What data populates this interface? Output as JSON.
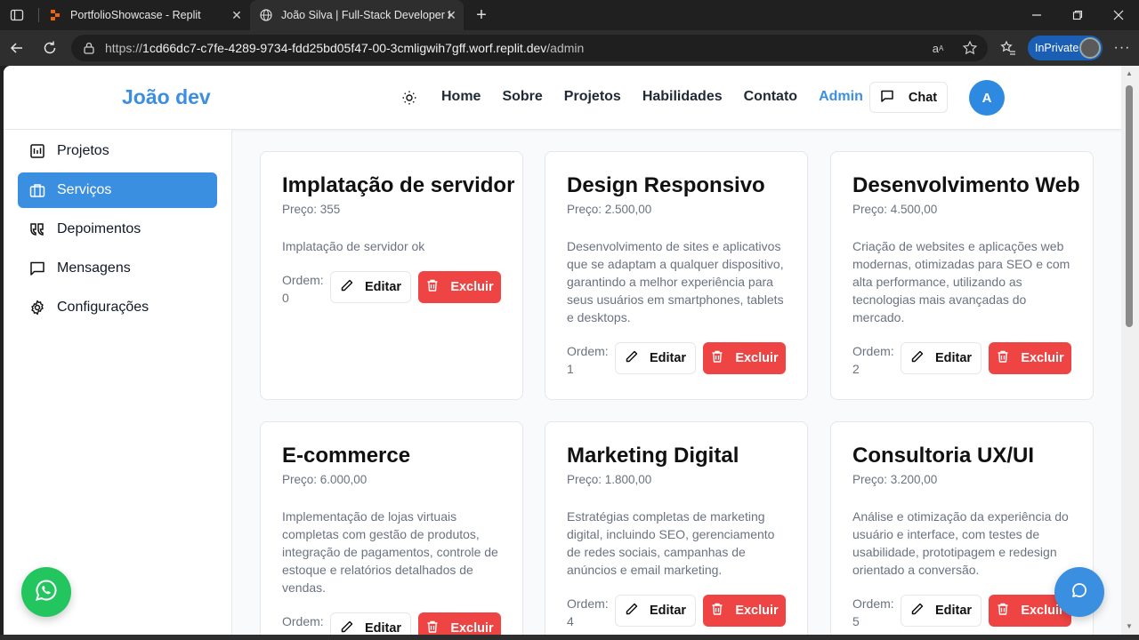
{
  "browser": {
    "tabs": [
      {
        "title": "PortfolioShowcase - Replit",
        "icon": "replit-icon"
      },
      {
        "title": "João Silva | Full-Stack Developer P",
        "icon": "globe-icon"
      }
    ],
    "url_prefix": "https://",
    "url_host": "1cd66dc7-c7fe-4289-9734-fdd25bd05f47-00-3cmligwih7gff.worf.replit.dev",
    "url_path": "/admin",
    "inprivate_label": "InPrivate"
  },
  "header": {
    "logo": "João dev",
    "nav": [
      "Home",
      "Sobre",
      "Projetos",
      "Habilidades",
      "Contato",
      "Admin"
    ],
    "chat_label": "Chat",
    "avatar_initial": "A"
  },
  "sidebar": {
    "items": [
      {
        "label": "Projetos",
        "icon": "chart-board-icon"
      },
      {
        "label": "Serviços",
        "icon": "briefcase-icon"
      },
      {
        "label": "Depoimentos",
        "icon": "quote-icon"
      },
      {
        "label": "Mensagens",
        "icon": "message-square-icon"
      },
      {
        "label": "Configurações",
        "icon": "settings-gear-icon"
      }
    ]
  },
  "services": [
    {
      "title": "Implatação de servidor",
      "price": "Preço: 355",
      "description": "Implatação de servidor ok",
      "order_label": "Ordem:",
      "order": "0"
    },
    {
      "title": "Design Responsivo",
      "price": "Preço: 2.500,00",
      "description": "Desenvolvimento de sites e aplicativos que se adaptam a qualquer dispositivo, garantindo a melhor experiência para seus usuários em smartphones, tablets e desktops.",
      "order_label": "Ordem:",
      "order": "1"
    },
    {
      "title": "Desenvolvimento Web",
      "price": "Preço: 4.500,00",
      "description": "Criação de websites e aplicações web modernas, otimizadas para SEO e com alta performance, utilizando as tecnologias mais avançadas do mercado.",
      "order_label": "Ordem:",
      "order": "2"
    },
    {
      "title": "E-commerce",
      "price": "Preço: 6.000,00",
      "description": "Implementação de lojas virtuais completas com gestão de produtos, integração de pagamentos, controle de estoque e relatórios detalhados de vendas.",
      "order_label": "Ordem:",
      "order": ""
    },
    {
      "title": "Marketing Digital",
      "price": "Preço: 1.800,00",
      "description": "Estratégias completas de marketing digital, incluindo SEO, gerenciamento de redes sociais, campanhas de anúncios e email marketing.",
      "order_label": "Ordem:",
      "order": "4"
    },
    {
      "title": "Consultoria UX/UI",
      "price": "Preço: 3.200,00",
      "description": "Análise e otimização da experiência do usuário e interface, com testes de usabilidade, prototipagem e redesign orientado a conversão.",
      "order_label": "Ordem:",
      "order": "5"
    }
  ],
  "actions": {
    "edit": "Editar",
    "delete": "Excluir"
  },
  "colors": {
    "primary": "#3b8fe0",
    "danger": "#ef4444",
    "whatsapp": "#22c55e"
  }
}
